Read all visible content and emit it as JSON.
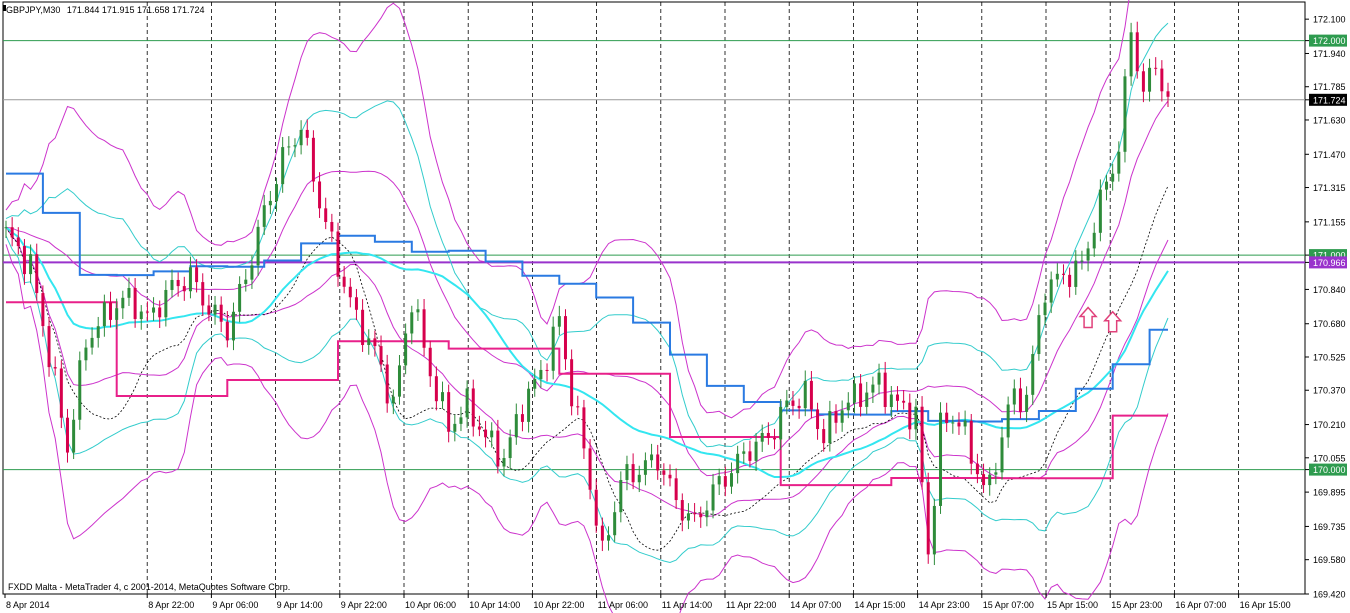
{
  "header": {
    "symbol_tf": "GBPJPY,M30",
    "ohlc": "171.844 171.915 171.658 171.724"
  },
  "footer": {
    "copyright": "FXDD Malta - MetaTrader 4, c 2001-2014, MetaQuotes Software Corp."
  },
  "colors": {
    "background": "#ffffff",
    "axis": "#000000",
    "level_lines": "#2e9b4f",
    "bull_candle": "#2e8b3a",
    "bear_candle": "#d6004c",
    "bollinger_outer": "#cc33cc",
    "bollinger_mid": "#33cccc",
    "ma_fast": "#33e6f0",
    "ichimoku_blue": "#2a7ae2",
    "step_pink": "#e8208a",
    "horizontal_purple": "#9933cc",
    "arrow": "#e0407a"
  },
  "chart_data": {
    "type": "candlestick",
    "symbol": "GBPJPY",
    "timeframe": "M30",
    "ylim": [
      169.42,
      172.18
    ],
    "y_ticks": [
      "172.100",
      "172.000",
      "171.940",
      "171.785",
      "171.724",
      "171.630",
      "171.470",
      "171.315",
      "171.155",
      "171.000",
      "170.966",
      "170.840",
      "170.680",
      "170.525",
      "170.370",
      "170.210",
      "170.055",
      "170.000",
      "169.895",
      "169.735",
      "169.580",
      "169.420"
    ],
    "highlighted_levels": [
      {
        "label": "172.000",
        "value": 172.0,
        "style": "green"
      },
      {
        "label": "171.724",
        "value": 171.724,
        "style": "current"
      },
      {
        "label": "171.000",
        "value": 171.0,
        "style": "green"
      },
      {
        "label": "170.966",
        "value": 170.966,
        "style": "purple"
      },
      {
        "label": "170.000",
        "value": 170.0,
        "style": "green"
      }
    ],
    "x_labels": [
      "8 Apr 2014",
      "8 Apr 22:00",
      "9 Apr 06:00",
      "9 Apr 14:00",
      "9 Apr 22:00",
      "10 Apr 06:00",
      "10 Apr 14:00",
      "10 Apr 22:00",
      "11 Apr 06:00",
      "11 Apr 14:00",
      "11 Apr 22:00",
      "14 Apr 07:00",
      "14 Apr 15:00",
      "14 Apr 23:00",
      "15 Apr 07:00",
      "15 Apr 15:00",
      "15 Apr 23:00",
      "16 Apr 07:00",
      "16 Apr 15:00"
    ],
    "price_path": [
      [
        0,
        171.1
      ],
      [
        4,
        170.95
      ],
      [
        8,
        170.4
      ],
      [
        10,
        170.1
      ],
      [
        13,
        170.6
      ],
      [
        17,
        170.75
      ],
      [
        20,
        170.8
      ],
      [
        23,
        170.7
      ],
      [
        27,
        170.85
      ],
      [
        30,
        170.9
      ],
      [
        33,
        170.75
      ],
      [
        36,
        170.65
      ],
      [
        39,
        170.9
      ],
      [
        42,
        171.2
      ],
      [
        45,
        171.45
      ],
      [
        48,
        171.6
      ],
      [
        51,
        171.25
      ],
      [
        54,
        170.95
      ],
      [
        57,
        170.7
      ],
      [
        60,
        170.55
      ],
      [
        63,
        170.3
      ],
      [
        66,
        170.8
      ],
      [
        69,
        170.45
      ],
      [
        72,
        170.2
      ],
      [
        75,
        170.3
      ],
      [
        78,
        170.15
      ],
      [
        81,
        170.05
      ],
      [
        84,
        170.3
      ],
      [
        87,
        170.45
      ],
      [
        90,
        170.7
      ],
      [
        92,
        170.35
      ],
      [
        94,
        170.1
      ],
      [
        97,
        169.6
      ],
      [
        100,
        169.95
      ],
      [
        103,
        170.0
      ],
      [
        106,
        170.05
      ],
      [
        109,
        169.85
      ],
      [
        112,
        169.75
      ],
      [
        115,
        169.9
      ],
      [
        118,
        170.0
      ],
      [
        121,
        170.1
      ],
      [
        124,
        170.15
      ],
      [
        127,
        170.3
      ],
      [
        130,
        170.35
      ],
      [
        133,
        170.15
      ],
      [
        136,
        170.3
      ],
      [
        139,
        170.35
      ],
      [
        142,
        170.4
      ],
      [
        145,
        170.3
      ],
      [
        148,
        170.25
      ],
      [
        150,
        169.6
      ],
      [
        152,
        170.2
      ],
      [
        155,
        170.25
      ],
      [
        157,
        170.05
      ],
      [
        160,
        169.9
      ],
      [
        163,
        170.3
      ],
      [
        166,
        170.35
      ],
      [
        169,
        170.85
      ],
      [
        172,
        170.9
      ],
      [
        175,
        170.95
      ],
      [
        178,
        171.25
      ],
      [
        181,
        171.5
      ],
      [
        183,
        172.05
      ],
      [
        185,
        171.75
      ],
      [
        187,
        171.9
      ],
      [
        189,
        171.7
      ]
    ],
    "bars": 190,
    "overlays": [
      "Bollinger Bands (outer, magenta)",
      "Bollinger Bands (inner, cyan)",
      "Moving average (cyan, thick)",
      "Step line (blue)",
      "Step line (pink)",
      "Dashed midline (black)"
    ],
    "markers": [
      {
        "type": "up-arrow",
        "bar": 176,
        "price": 170.7
      },
      {
        "type": "up-arrow",
        "bar": 180,
        "price": 170.68
      }
    ],
    "grid": "vertical dashed at x labels"
  }
}
